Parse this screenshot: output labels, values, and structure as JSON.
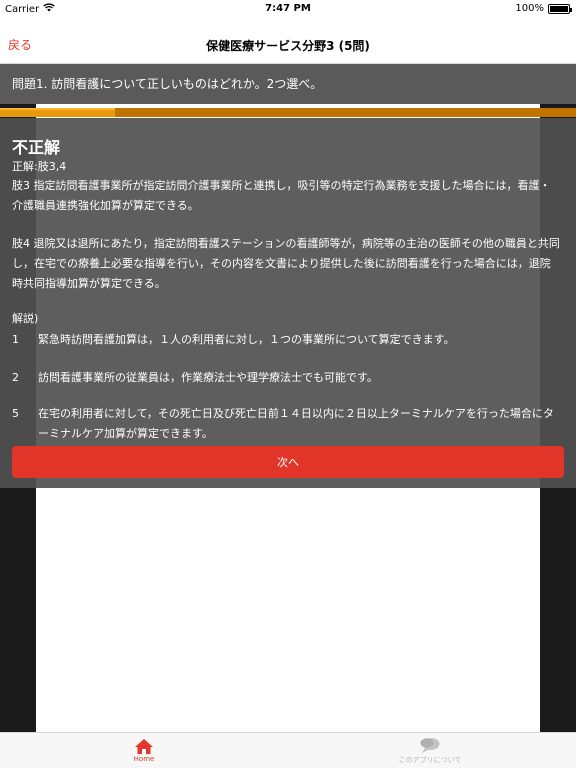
{
  "status_bar": {
    "carrier": "Carrier",
    "time": "7:47 PM",
    "battery": "100%",
    "battery_level": 1.0
  },
  "nav": {
    "back_label": "戻る",
    "title": "保健医療サービス分野3 (5問)"
  },
  "question": {
    "text": "問題1. 訪問看護について正しいものはどれか。2つ選べ。",
    "progress": 0.2
  },
  "result": {
    "title": "不正解",
    "correct_answer": "正解:肢3,4",
    "choices": [
      "肢3 指定訪問看護事業所が指定訪問介護事業所と連携し，吸引等の特定行為業務を支援した場合には，看護・介護職員連携強化加算が算定できる。",
      "肢4 退院又は退所にあたり，指定訪問看護ステーションの看護師等が，病院等の主治の医師その他の職員と共同し，在宅での療養上必要な指導を行い，その内容を文書により提供した後に訪問看護を行った場合には，退院時共同指導加算が算定できる。"
    ],
    "explanation_heading": "解説)",
    "explanations": [
      {
        "num": "1",
        "text": "緊急時訪問看護加算は，１人の利用者に対し，１つの事業所について算定できます。"
      },
      {
        "num": "2",
        "text": "訪問看護事業所の従業員は，作業療法士や理学療法士でも可能です。"
      },
      {
        "num": "5",
        "text": "在宅の利用者に対して，その死亡日及び死亡日前１４日以内に２日以上ターミナルケアを行った場合にターミナルケア加算が算定できます。"
      }
    ]
  },
  "next_button": {
    "label": "次へ"
  },
  "tabs": [
    {
      "label": "Home",
      "icon": "home-icon"
    },
    {
      "label": "このアプリについて",
      "icon": "chat-bubble-icon"
    }
  ],
  "colors": {
    "accent": "#e0392b",
    "progress": "#e89a0e",
    "button": "#e2352a"
  }
}
